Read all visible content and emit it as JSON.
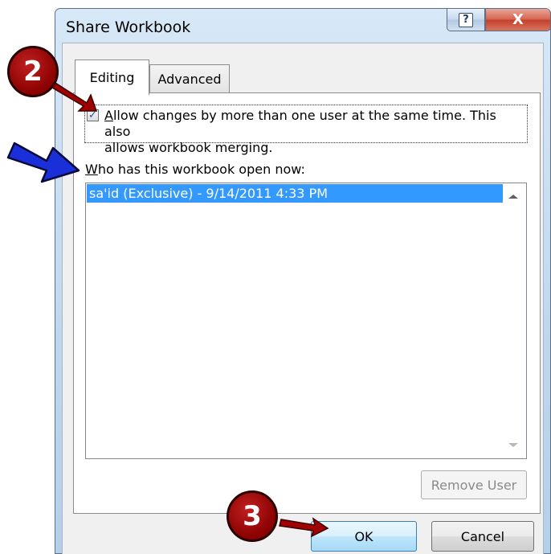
{
  "window": {
    "title": "Share Workbook",
    "help_glyph": "?",
    "close_glyph": "X"
  },
  "tabs": [
    {
      "label": "Editing",
      "selected": true
    },
    {
      "label": "Advanced",
      "selected": false
    }
  ],
  "editing": {
    "allow_changes_checked": true,
    "allow_changes_label_line1": "Allow changes by more than one user at the same time.  This also",
    "allow_changes_label_line2": "allows workbook merging.",
    "allow_changes_mnemonic": "A",
    "who_has_open_label": "Who has this workbook open now:",
    "who_has_open_mnemonic": "W",
    "users": [
      {
        "text": "sa'id (Exclusive) - 9/14/2011 4:33 PM",
        "selected": true
      }
    ],
    "remove_user_label": "Remove User"
  },
  "buttons": {
    "ok_label": "OK",
    "cancel_label": "Cancel"
  },
  "callouts": [
    {
      "number": "2"
    },
    {
      "number": "3"
    }
  ],
  "colors": {
    "selection": "#3399ff",
    "callout_red": "#a00000",
    "arrow_blue": "#1a2fd8"
  }
}
